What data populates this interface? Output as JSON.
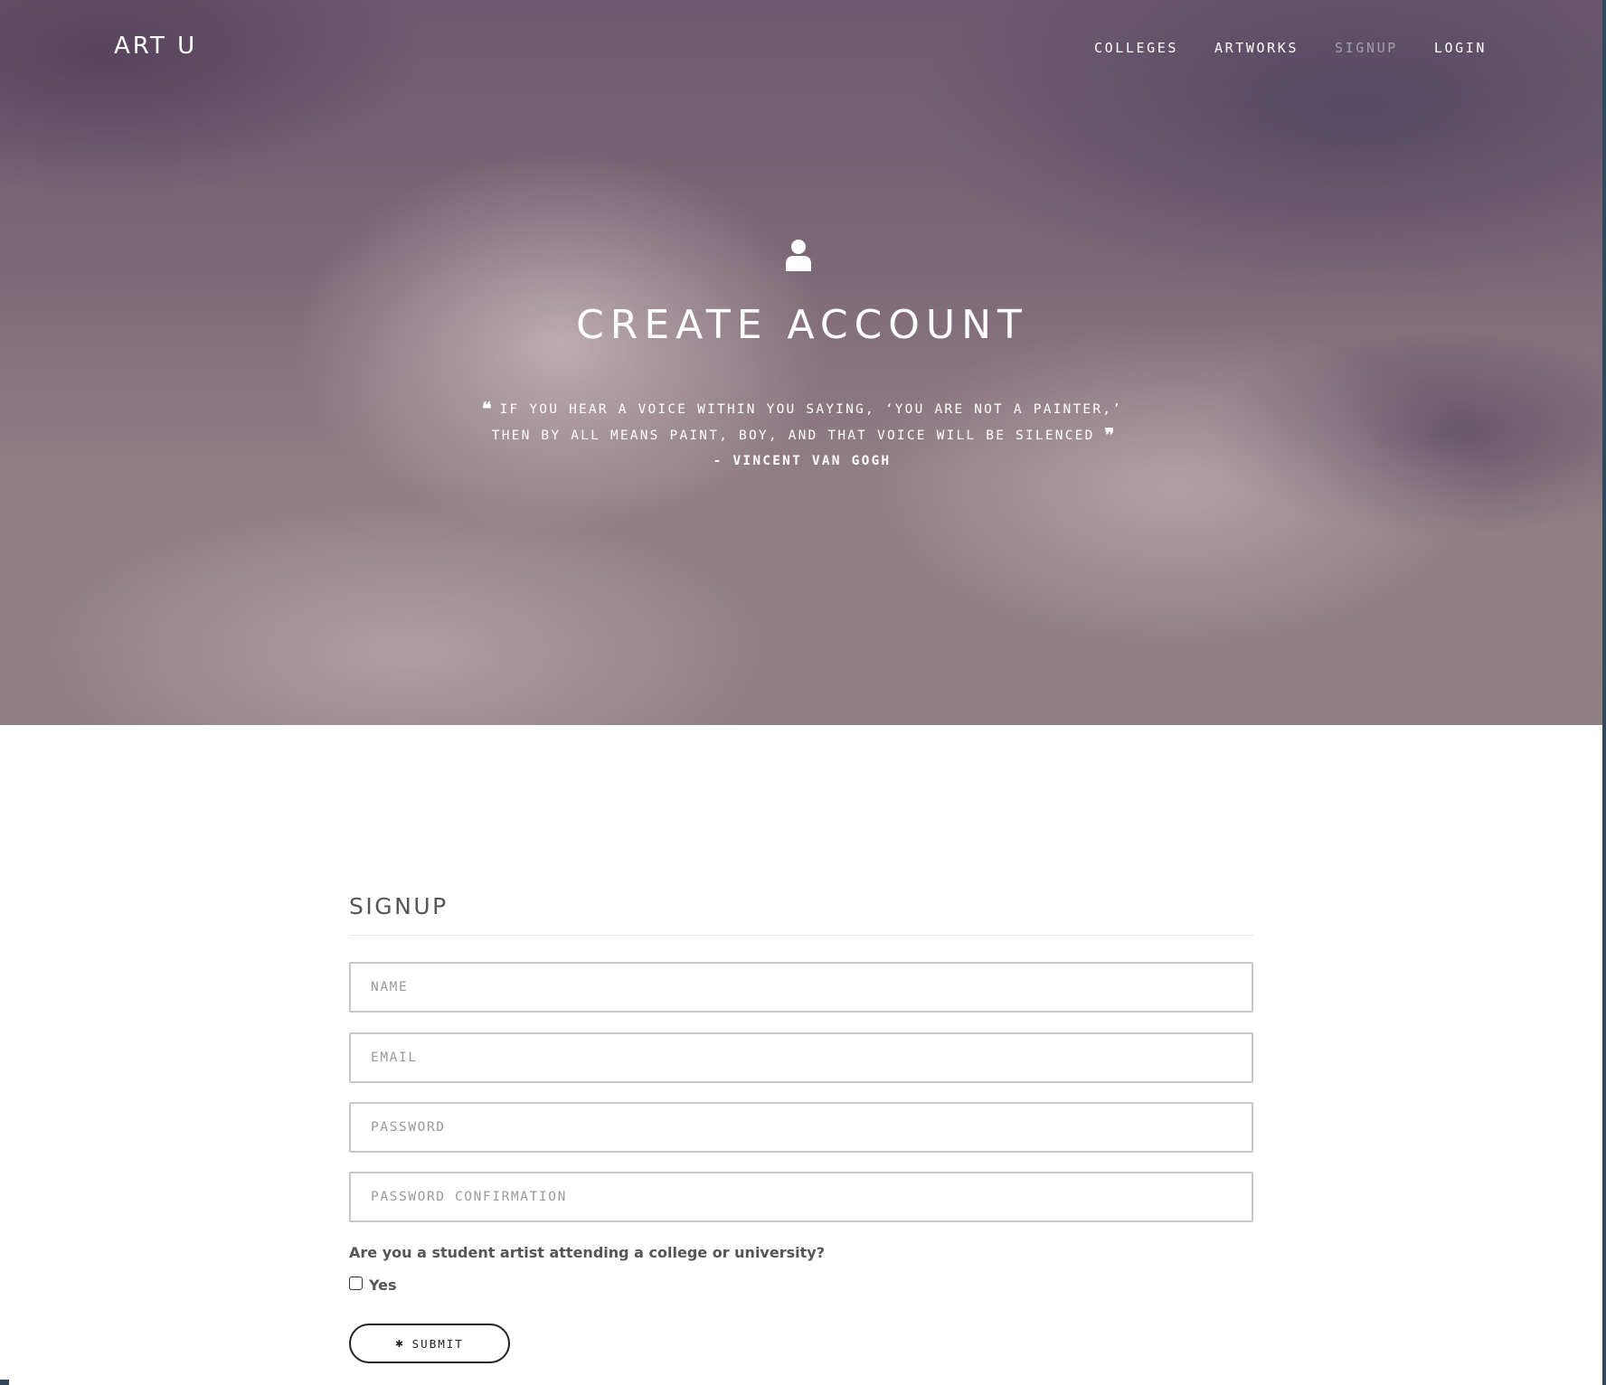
{
  "brand": "ART U",
  "nav": {
    "items": [
      {
        "label": "COLLEGES",
        "active": false
      },
      {
        "label": "ARTWORKS",
        "active": false
      },
      {
        "label": "SIGNUP",
        "active": true
      },
      {
        "label": "LOGIN",
        "active": false
      }
    ]
  },
  "hero": {
    "icon": "user-icon",
    "title": "CREATE ACCOUNT",
    "quote_line1": "IF YOU HEAR A VOICE WITHIN YOU SAYING, ‘YOU ARE NOT A PAINTER,’",
    "quote_line2": "THEN BY ALL MEANS PAINT, BOY, AND THAT VOICE WILL BE SILENCED",
    "author": "- VINCENT VAN GOGH",
    "open_quote_glyph": "❝",
    "close_quote_glyph": "❞"
  },
  "form": {
    "title": "SIGNUP",
    "fields": {
      "name": {
        "placeholder": "NAME",
        "value": ""
      },
      "email": {
        "placeholder": "EMAIL",
        "value": ""
      },
      "password": {
        "placeholder": "PASSWORD",
        "value": ""
      },
      "password_confirmation": {
        "placeholder": "PASSWORD CONFIRMATION",
        "value": ""
      }
    },
    "question": "Are you a student artist attending a college or university?",
    "checkbox_label": "Yes",
    "checkbox_checked": false,
    "submit_icon": "gear-icon",
    "submit_label": "SUBMIT"
  },
  "colors": {
    "hero_tint": "#7c6775",
    "text_dark": "#555555",
    "border": "#c6c6c6"
  }
}
